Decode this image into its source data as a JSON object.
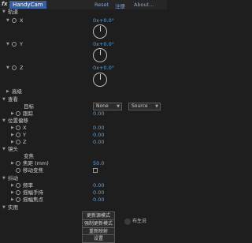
{
  "header": {
    "fx": "fx",
    "effect_name": "HandyCam",
    "reset": "Reset",
    "register": "注册",
    "about": "About..."
  },
  "rows": {
    "track": "轨道",
    "x": "X",
    "x_val": "0x+0.0°",
    "y": "Y",
    "y_val": "0x+0.0°",
    "z": "Z",
    "z_val": "0x+0.0°",
    "advanced": "高级",
    "look": "查看",
    "target": "目标",
    "target_dd1": "None",
    "target_dd2": "Source",
    "follow": "跟踪",
    "follow_val": "0.00",
    "pos_offset": "位置偏移",
    "px": "X",
    "px_val": "0.00",
    "py": "Y",
    "py_val": "0.00",
    "pz": "Z",
    "pz_val": "0.00",
    "lens": "镜头",
    "zoom": "变焦",
    "focal": "焦距 (mm)",
    "focal_val": "50.0",
    "move_zoom": "移动变焦",
    "shake": "抖动",
    "freq": "频率",
    "freq_val": "0.00",
    "sway_hand": "摇幅手持",
    "sway_hand_val": "0.00",
    "sway_point": "摇幅焦点",
    "sway_point_val": "0.00",
    "practical": "实用"
  },
  "buttons": [
    "更新源模式",
    "强制更新模式",
    "重新映射",
    "设置"
  ],
  "watermark": "布生说"
}
